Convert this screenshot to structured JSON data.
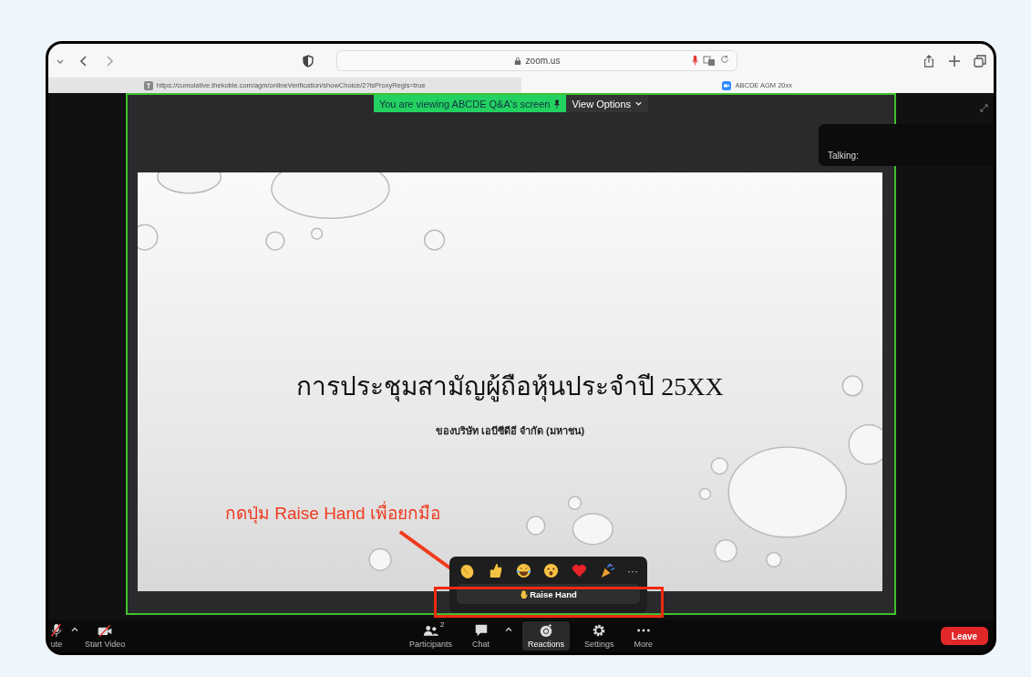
{
  "browser": {
    "address": "zoom.us",
    "tabs": [
      {
        "label": "https://cumulative.thekoble.com/agm/onlineVerification/showChoice/2?isProxyRegis=true",
        "selected": false
      },
      {
        "label": "ABCDE AGM 20xx",
        "selected": true
      }
    ]
  },
  "share_banner": {
    "text": "You are viewing ABCDE Q&A's screen",
    "view_options": "View Options"
  },
  "talking_panel": {
    "label": "Talking:"
  },
  "slide": {
    "title": "การประชุมสามัญผู้ถือหุ้นประจำปี 25XX",
    "subtitle": "ของบริษัท เอบีซีดีอี จำกัด (มหาชน)"
  },
  "annotation": {
    "text": "กดปุ่ม Raise Hand เพื่อยกมือ"
  },
  "reactions_popup": {
    "reactions": [
      {
        "kind": "clap"
      },
      {
        "kind": "thumbs"
      },
      {
        "kind": "laugh"
      },
      {
        "kind": "wow"
      },
      {
        "kind": "heart"
      },
      {
        "kind": "party"
      }
    ],
    "more": "···",
    "raise_hand": "Raise Hand"
  },
  "toolbar": {
    "left": [
      {
        "kind": "mic",
        "label": "ute"
      },
      {
        "kind": "video",
        "label": "Start Video"
      }
    ],
    "center": [
      {
        "kind": "participants",
        "label": "Participants",
        "count": "2",
        "selected": false
      },
      {
        "kind": "chat",
        "label": "Chat",
        "selected": false
      },
      {
        "kind": "reactions",
        "label": "Reactions",
        "selected": true
      },
      {
        "kind": "settings",
        "label": "Settings",
        "selected": false
      },
      {
        "kind": "more",
        "label": "More",
        "selected": false
      }
    ],
    "leave": "Leave"
  }
}
